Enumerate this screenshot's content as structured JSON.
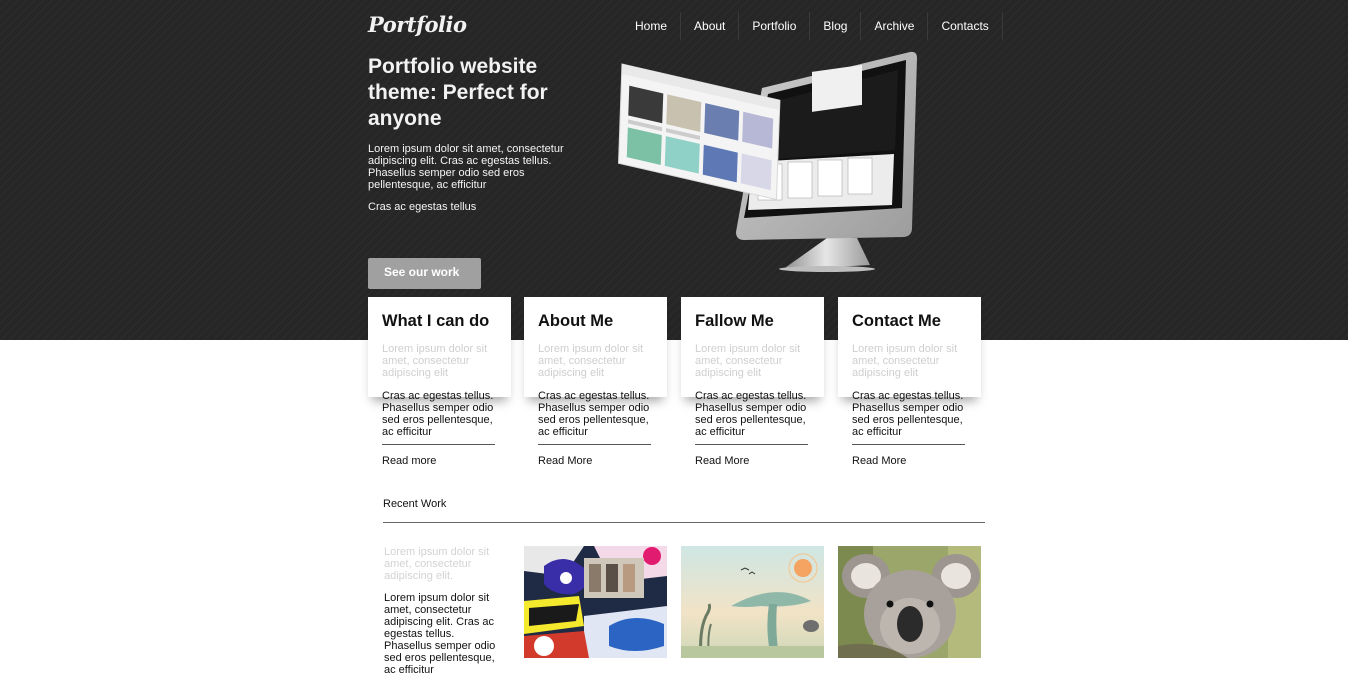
{
  "header": {
    "logo": "Portfolio",
    "nav": [
      "Home",
      "About",
      "Portfolio",
      "Blog",
      "Archive",
      "Contacts"
    ]
  },
  "hero": {
    "title": "Portfolio website theme: Perfect for anyone",
    "text": "Lorem ipsum dolor sit amet, consectetur adipiscing elit. Cras ac egestas tellus. Phasellus semper odio sed eros pellentesque, ac efficitur",
    "subtext": "Cras ac egestas tellus",
    "cta": "See our work"
  },
  "cards": [
    {
      "title": "What I can do",
      "muted": "Lorem ipsum dolor sit amet, consectetur adipiscing elit",
      "text": "Cras ac egestas tellus. Phasellus semper odio sed eros pellentesque, ac efficitur",
      "link": "Read more"
    },
    {
      "title": "About Me",
      "muted": "Lorem ipsum dolor sit amet, consectetur adipiscing elit",
      "text": "Cras ac egestas tellus. Phasellus semper odio sed eros pellentesque, ac efficitur",
      "link": "Read More"
    },
    {
      "title": "Fallow Me",
      "muted": "Lorem ipsum dolor sit amet, consectetur adipiscing elit",
      "text": "Cras ac egestas tellus. Phasellus semper odio sed eros pellentesque, ac efficitur",
      "link": "Read More"
    },
    {
      "title": "Contact Me",
      "muted": "Lorem ipsum dolor sit amet, consectetur adipiscing elit",
      "text": "Cras ac egestas tellus. Phasellus semper odio sed eros pellentesque, ac efficitur",
      "link": "Read More"
    }
  ],
  "recent": {
    "title": "Recent Work",
    "muted": "Lorem ipsum dolor sit amet, consectetur adipiscing elit.",
    "text": "Lorem ipsum dolor sit amet, consectetur adipiscing elit. Cras ac egestas tellus. Phasellus semper odio sed eros pellentesque, ac efficitur",
    "thumbs": [
      "sticker-collage-image",
      "surreal-landscape-image",
      "koala-photo"
    ]
  },
  "colors": {
    "hero_bg": "#262626",
    "cta_bg": "#a0a0a0",
    "text_dark": "#111111",
    "text_muted": "#cfcfcf"
  }
}
